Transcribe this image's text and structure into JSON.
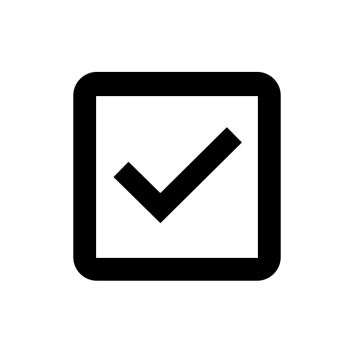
{
  "icon": {
    "name": "checked-checkbox-icon",
    "state": "checked",
    "stroke_color": "#000000",
    "fill_color": "#ffffff",
    "background_color": "#ffffff"
  }
}
